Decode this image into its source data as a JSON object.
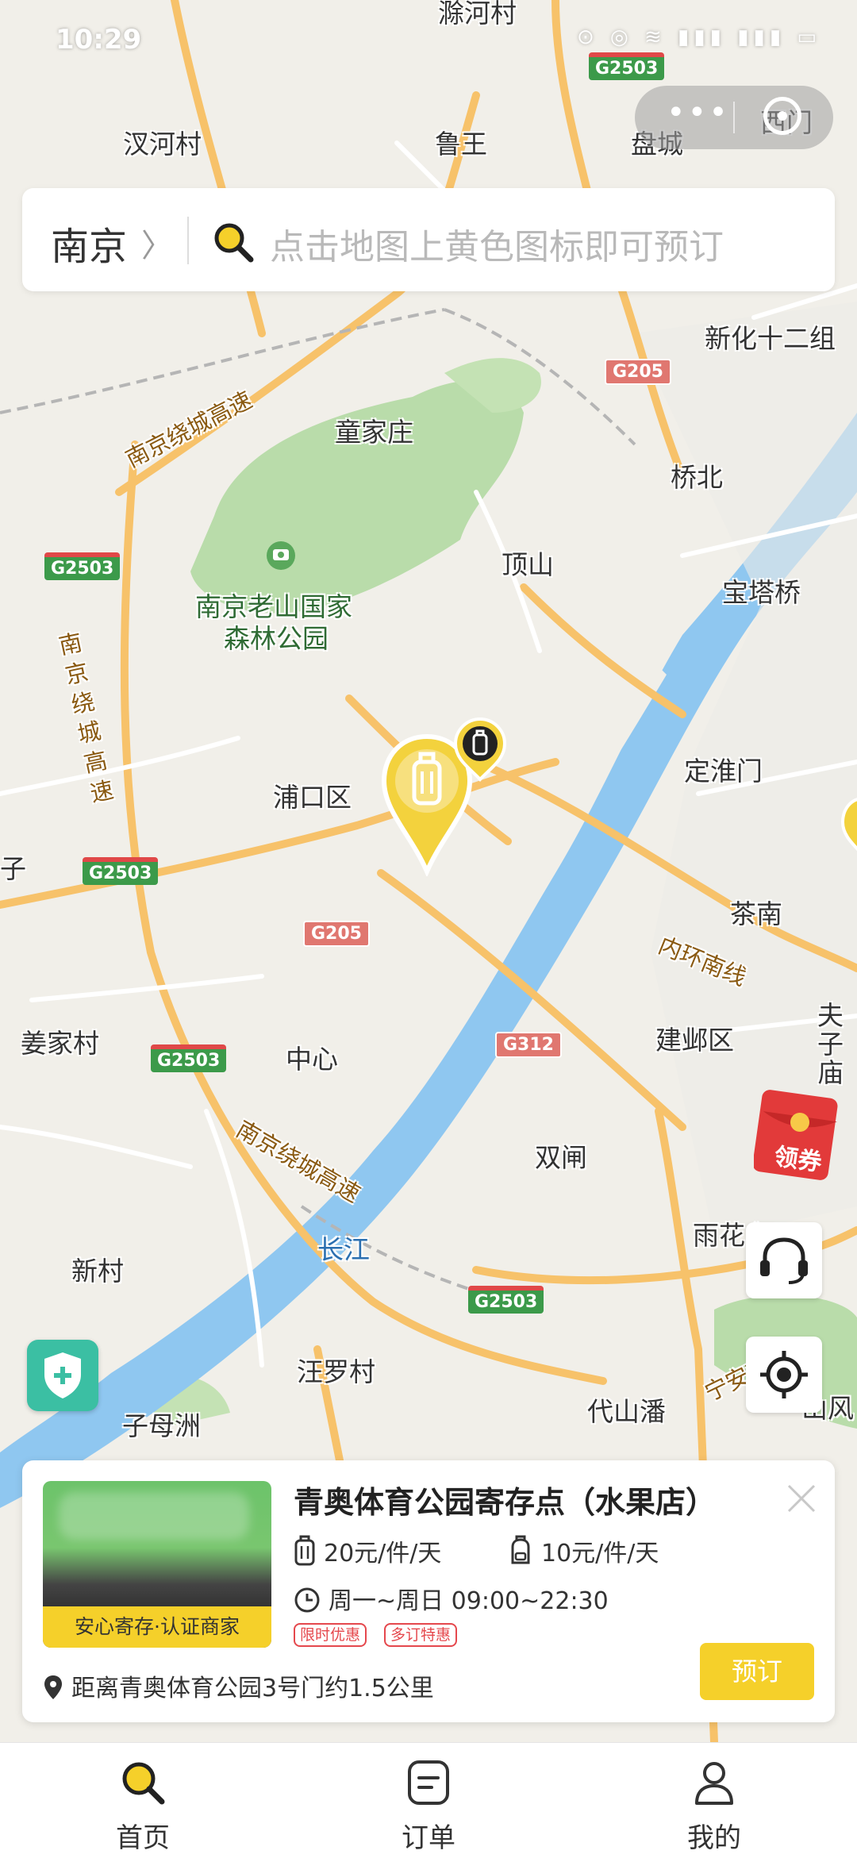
{
  "status_bar": {
    "time": "10:29",
    "icons_text": "⊙ ◎ ≋ ▮▮▮ ▮▮▮ ▭"
  },
  "capsule": {
    "more_icon": "more-dots-icon",
    "close_icon": "miniprogram-close-icon"
  },
  "search": {
    "city": "南京",
    "placeholder": "点击地图上黄色图标即可预订"
  },
  "map": {
    "labels": [
      {
        "text": "滁河村",
        "kind": "place"
      },
      {
        "text": "汊河村",
        "kind": "place"
      },
      {
        "text": "鲁王",
        "kind": "place"
      },
      {
        "text": "盘城",
        "kind": "place"
      },
      {
        "text": "西门",
        "kind": "place"
      },
      {
        "text": "新化十二组",
        "kind": "place"
      },
      {
        "text": "童家庄",
        "kind": "place"
      },
      {
        "text": "桥北",
        "kind": "place"
      },
      {
        "text": "南京绕城高速",
        "kind": "road"
      },
      {
        "text": "顶山",
        "kind": "place"
      },
      {
        "text": "宝塔桥",
        "kind": "place"
      },
      {
        "text": "南京老山国家",
        "kind": "park"
      },
      {
        "text": "森林公园",
        "kind": "park"
      },
      {
        "text": "南京绕城高速",
        "kind": "road-vertical"
      },
      {
        "text": "浦口区",
        "kind": "place"
      },
      {
        "text": "定淮门",
        "kind": "place"
      },
      {
        "text": "子",
        "kind": "place"
      },
      {
        "text": "茶南",
        "kind": "place"
      },
      {
        "text": "内环南线",
        "kind": "road"
      },
      {
        "text": "姜家村",
        "kind": "place"
      },
      {
        "text": "中心",
        "kind": "place"
      },
      {
        "text": "建邺区",
        "kind": "place"
      },
      {
        "text": "夫子庙",
        "kind": "place"
      },
      {
        "text": "南京绕城高速",
        "kind": "road"
      },
      {
        "text": "双闸",
        "kind": "place"
      },
      {
        "text": "长江",
        "kind": "water"
      },
      {
        "text": "新村",
        "kind": "place"
      },
      {
        "text": "雨花台区",
        "kind": "place"
      },
      {
        "text": "汪罗村",
        "kind": "place"
      },
      {
        "text": "代山潘",
        "kind": "place"
      },
      {
        "text": "宁安高速",
        "kind": "road"
      },
      {
        "text": "子母洲",
        "kind": "place"
      },
      {
        "text": "山风",
        "kind": "place"
      }
    ],
    "shields": [
      "G2503",
      "G205",
      "G2503",
      "G2503",
      "G205",
      "G312",
      "G2503",
      "G2503"
    ]
  },
  "coupon": {
    "label": "领券"
  },
  "store_card": {
    "title": "青奥体育公园寄存点（水果店）",
    "badge": "安心寄存·认证商家",
    "luggage_price": "20元/件/天",
    "bag_price": "10元/件/天",
    "hours": "周一~周日 09:00~22:30",
    "tags": [
      "限时优惠",
      "多订特惠"
    ],
    "distance": "距离青奥体育公园3号门约1.5公里",
    "book_label": "预订"
  },
  "tabs": [
    {
      "label": "首页",
      "icon": "search-icon",
      "active": true
    },
    {
      "label": "订单",
      "icon": "order-list-icon",
      "active": false
    },
    {
      "label": "我的",
      "icon": "user-icon",
      "active": false
    }
  ],
  "colors": {
    "accent": "#f5d02a",
    "river": "#8fc7f0",
    "park": "#b9dcaa",
    "major_road": "#f7c26a"
  }
}
